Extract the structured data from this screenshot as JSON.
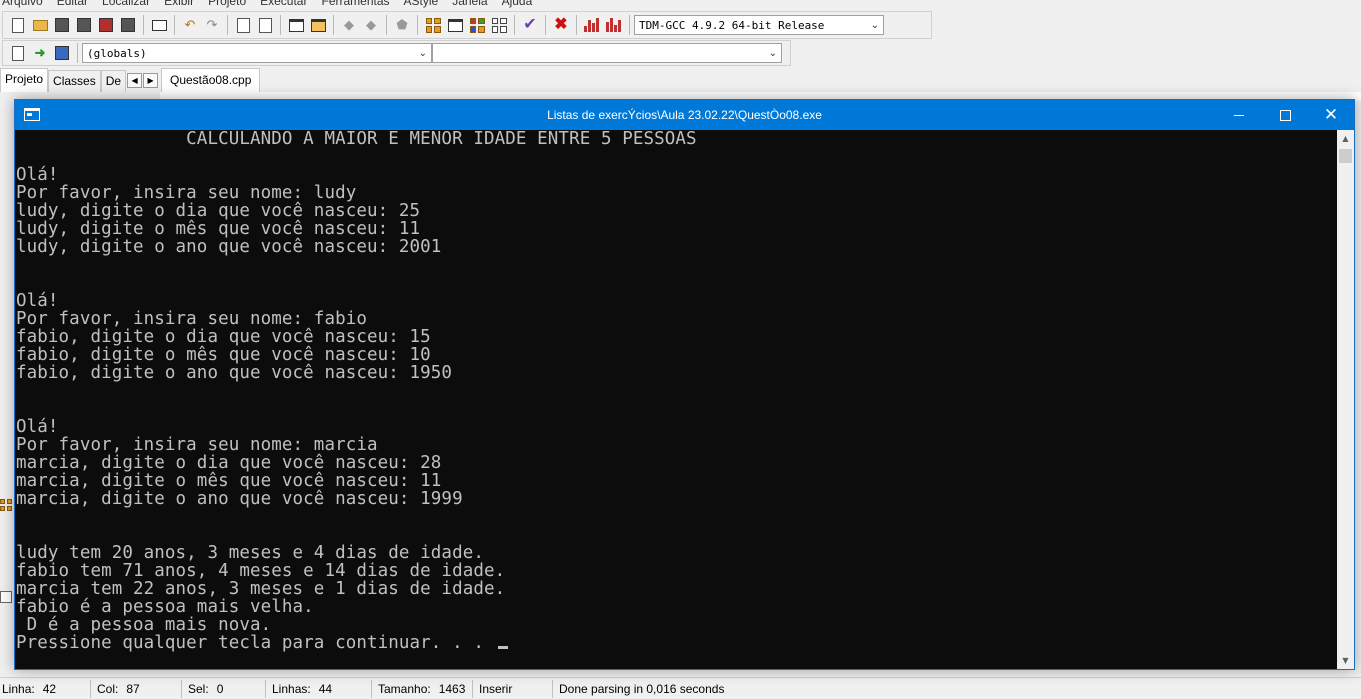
{
  "ide": {
    "menu": [
      "Arquivo",
      "Editar",
      "Localizar",
      "Exibir",
      "Projeto",
      "Executar",
      "Ferramentas",
      "AStyle",
      "Janela",
      "Ajuda"
    ],
    "compiler_select": "TDM-GCC 4.9.2 64-bit Release",
    "scope_select": "(globals)",
    "left_tabs": [
      "Projeto",
      "Classes",
      "De"
    ],
    "file_tab": "Questão08.cpp"
  },
  "console": {
    "title": "Listas de exercÝcios\\Aula 23.02.22\\QuestÒo08.exe",
    "lines": [
      "                CALCULANDO A MAIOR E MENOR IDADE ENTRE 5 PESSOAS",
      "",
      "Olá!",
      "Por favor, insira seu nome: ludy",
      "ludy, digite o dia que você nasceu: 25",
      "ludy, digite o mês que você nasceu: 11",
      "ludy, digite o ano que você nasceu: 2001",
      "",
      "",
      "Olá!",
      "Por favor, insira seu nome: fabio",
      "fabio, digite o dia que você nasceu: 15",
      "fabio, digite o mês que você nasceu: 10",
      "fabio, digite o ano que você nasceu: 1950",
      "",
      "",
      "Olá!",
      "Por favor, insira seu nome: marcia",
      "marcia, digite o dia que você nasceu: 28",
      "marcia, digite o mês que você nasceu: 11",
      "marcia, digite o ano que você nasceu: 1999",
      "",
      "",
      "ludy tem 20 anos, 3 meses e 4 dias de idade.",
      "fabio tem 71 anos, 4 meses e 14 dias de idade.",
      "marcia tem 22 anos, 3 meses e 1 dias de idade.",
      "fabio é a pessoa mais velha.",
      " D é a pessoa mais nova.",
      "Pressione qualquer tecla para continuar. . . "
    ]
  },
  "status": {
    "linha_label": "Linha:",
    "linha": "42",
    "col_label": "Col:",
    "col": "87",
    "sel_label": "Sel:",
    "sel": "0",
    "linhas_label": "Linhas:",
    "linhas": "44",
    "tamanho_label": "Tamanho:",
    "tamanho": "1463",
    "mode": "Inserir",
    "message": "Done parsing in 0,016 seconds"
  }
}
